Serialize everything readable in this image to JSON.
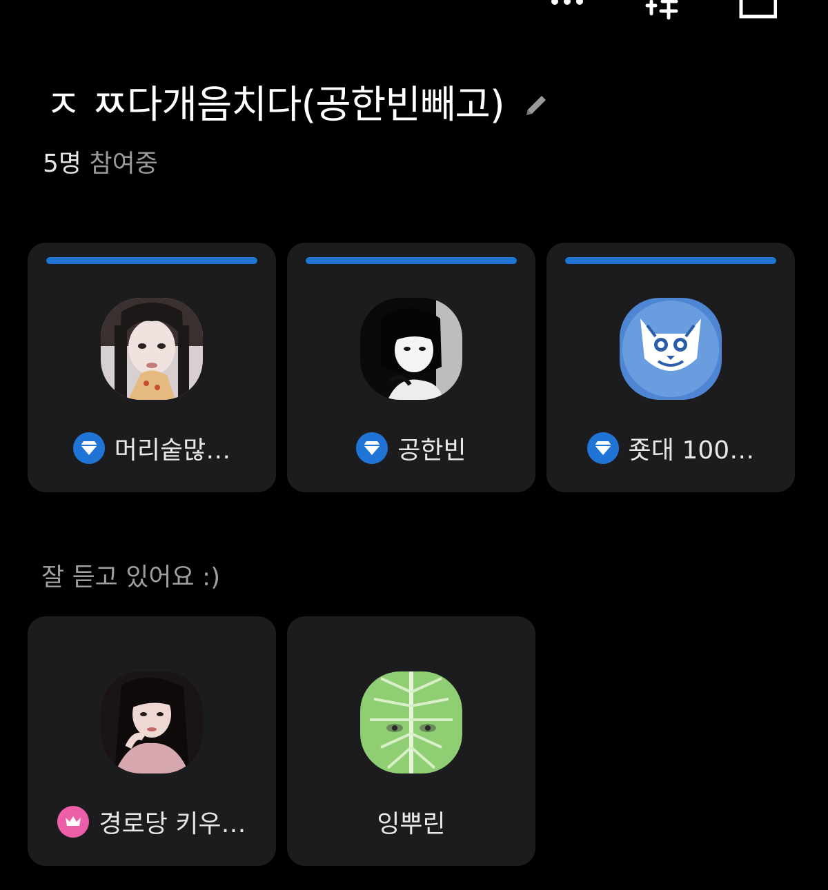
{
  "toolbar": {
    "more_icon": "more-horizontal-icon",
    "add_people_icon": "add-people-icon",
    "minimize_icon": "minimize-icon"
  },
  "room": {
    "title": "ㅈ ㅉ다개음치다(공한빈빼고)",
    "edit_icon": "pencil-icon",
    "participant_count": "5명",
    "participant_suffix": " 참여중"
  },
  "speakers": [
    {
      "name": "머리숱많…",
      "badge": "diamond-icon",
      "badge_color": "#1f74d6",
      "speaking": true
    },
    {
      "name": "공한빈",
      "badge": "diamond-icon",
      "badge_color": "#1f74d6",
      "speaking": true
    },
    {
      "name": "죳대 100…",
      "badge": "diamond-icon",
      "badge_color": "#1f74d6",
      "speaking": true
    }
  ],
  "listeners_label": "잘 듣고 있어요 :)",
  "listeners": [
    {
      "name": "경로당 키우…",
      "badge": "crown-icon",
      "badge_color": "#ec5fa8"
    },
    {
      "name": "잉뿌린",
      "badge": null
    }
  ],
  "colors": {
    "background": "#000000",
    "card": "#1c1c1e",
    "speaking_bar": "#1f74d6",
    "badge_blue": "#1f74d6",
    "badge_pink": "#ec5fa8"
  }
}
